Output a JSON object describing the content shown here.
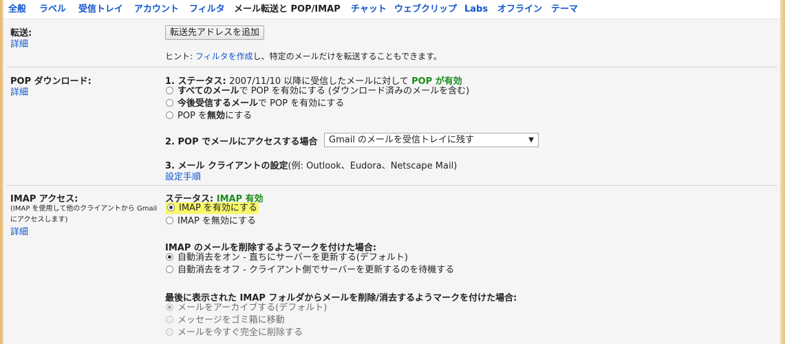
{
  "tabs": [
    "全般",
    "ラベル",
    "受信トレイ",
    "アカウント",
    "フィルタ",
    "メール転送と POP/IMAP",
    "チャット",
    "ウェブクリップ",
    "Labs",
    "オフライン",
    "テーマ"
  ],
  "forwarding": {
    "label": "転送:",
    "detail": "詳細",
    "add_button": "転送先アドレスを追加",
    "hint_prefix": "ヒント: ",
    "hint_link": "フィルタを作成",
    "hint_suffix": "し、特定のメールだけを転送することもできます。"
  },
  "pop": {
    "label": "POP ダウンロード:",
    "detail": "詳細",
    "status_num": "1. ステータス: ",
    "status_text": "2007/11/10 以降に受信したメールに対して ",
    "status_value": "POP が有効",
    "opt1_bold": "すべてのメール",
    "opt1_rest": "で POP を有効にする (ダウンロード済みのメールを含む)",
    "opt2_bold": "今後受信するメール",
    "opt2_rest": "で POP を有効にする",
    "opt3_prefix": "POP を",
    "opt3_bold": "無効",
    "opt3_suffix": "にする",
    "access_label": "2. POP でメールにアクセスする場合",
    "access_select": "Gmail のメールを受信トレイに残す",
    "client_label": "3. メール クライアントの設定",
    "client_example": "(例: Outlook、Eudora、Netscape Mail)",
    "setup_link": "設定手順"
  },
  "imap": {
    "label": "IMAP アクセス:",
    "note": "(IMAP を使用して他のクライアントから Gmail にアクセスします)",
    "detail": "詳細",
    "status_label": "ステータス: ",
    "status_value": "IMAP 有効",
    "enable": "IMAP を有効にする",
    "disable": "IMAP を無効にする",
    "delete_heading": "IMAP のメールを削除するようマークを付けた場合:",
    "autoexpunge_on": "自動消去をオン - 直ちにサーバーを更新する(デフォルト)",
    "autoexpunge_off": "自動消去をオフ - クライアント側でサーバーを更新するのを待機する",
    "last_heading": "最後に表示された IMAP フォルダからメールを削除/消去するようマークを付けた場合:",
    "archive": "メールをアーカイブする(デフォルト)",
    "trash": "メッセージをゴミ箱に移動",
    "delete_forever": "メールを今すぐ完全に削除する"
  },
  "colors": {
    "link": "#1155cc",
    "status_green": "#1c8c1c",
    "highlight": "#f7f76a"
  }
}
